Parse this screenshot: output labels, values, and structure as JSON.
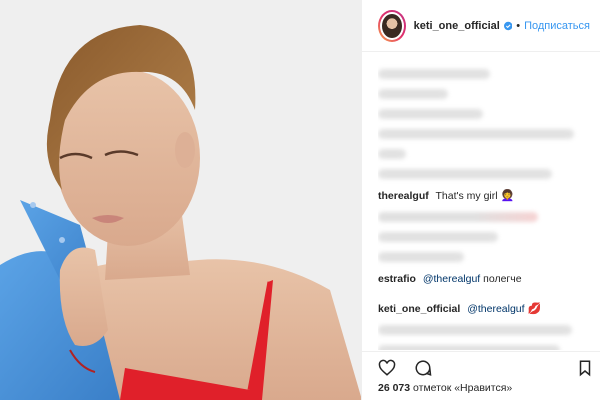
{
  "post": {
    "author": "keti_one_official",
    "follow_label": "Подписаться",
    "separator": "•"
  },
  "comments": [
    {
      "user": "therealguf",
      "text": "That's my girl",
      "emoji": "👩‍🦱"
    },
    {
      "user": "estrafio",
      "mention": "@therealguf",
      "text": "полегче"
    },
    {
      "user": "keti_one_official",
      "mention": "@therealguf",
      "emoji": "💋"
    }
  ],
  "footer": {
    "likes_count": "26 073",
    "likes_text": "отметок «Нравится»"
  },
  "icons": {
    "like": "heart-icon",
    "comment": "comment-icon",
    "save": "bookmark-icon"
  },
  "colors": {
    "accent": "#3897f0",
    "mention": "#003569",
    "dress": "#e0202a",
    "jacket": "#4a90d9"
  }
}
